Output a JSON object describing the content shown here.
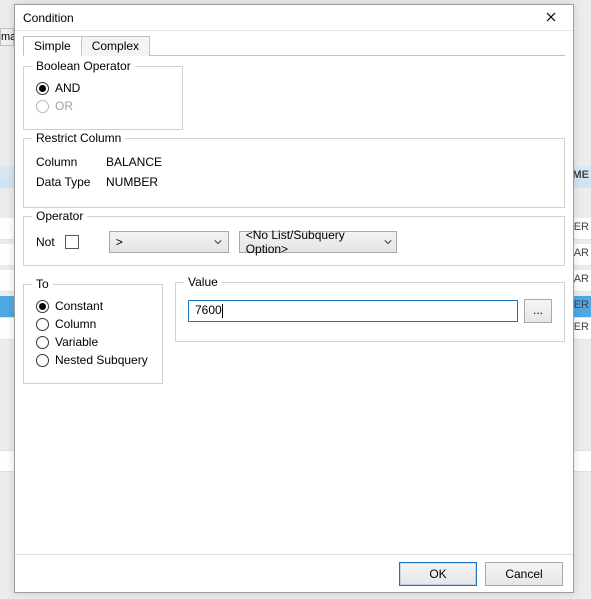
{
  "dialog": {
    "title": "Condition"
  },
  "tabs": {
    "simple": "Simple",
    "complex": "Complex"
  },
  "boolean": {
    "legend": "Boolean Operator",
    "and": "AND",
    "or": "OR"
  },
  "restrict": {
    "legend": "Restrict Column",
    "column_label": "Column",
    "column_value": "BALANCE",
    "type_label": "Data Type",
    "type_value": "NUMBER"
  },
  "operator": {
    "legend": "Operator",
    "not_label": "Not",
    "op1": ">",
    "op2": "<No List/Subquery Option>"
  },
  "to": {
    "legend": "To",
    "constant": "Constant",
    "column": "Column",
    "variable": "Variable",
    "nested": "Nested Subquery"
  },
  "value": {
    "legend": "Value",
    "text": "7600",
    "browse": "..."
  },
  "footer": {
    "ok": "OK",
    "cancel": "Cancel"
  },
  "bg": {
    "left_tab": "ma",
    "hdr_cell": "OME",
    "cells": [
      "BER",
      "CHAR",
      "CHAR",
      "ER",
      "BER"
    ]
  }
}
